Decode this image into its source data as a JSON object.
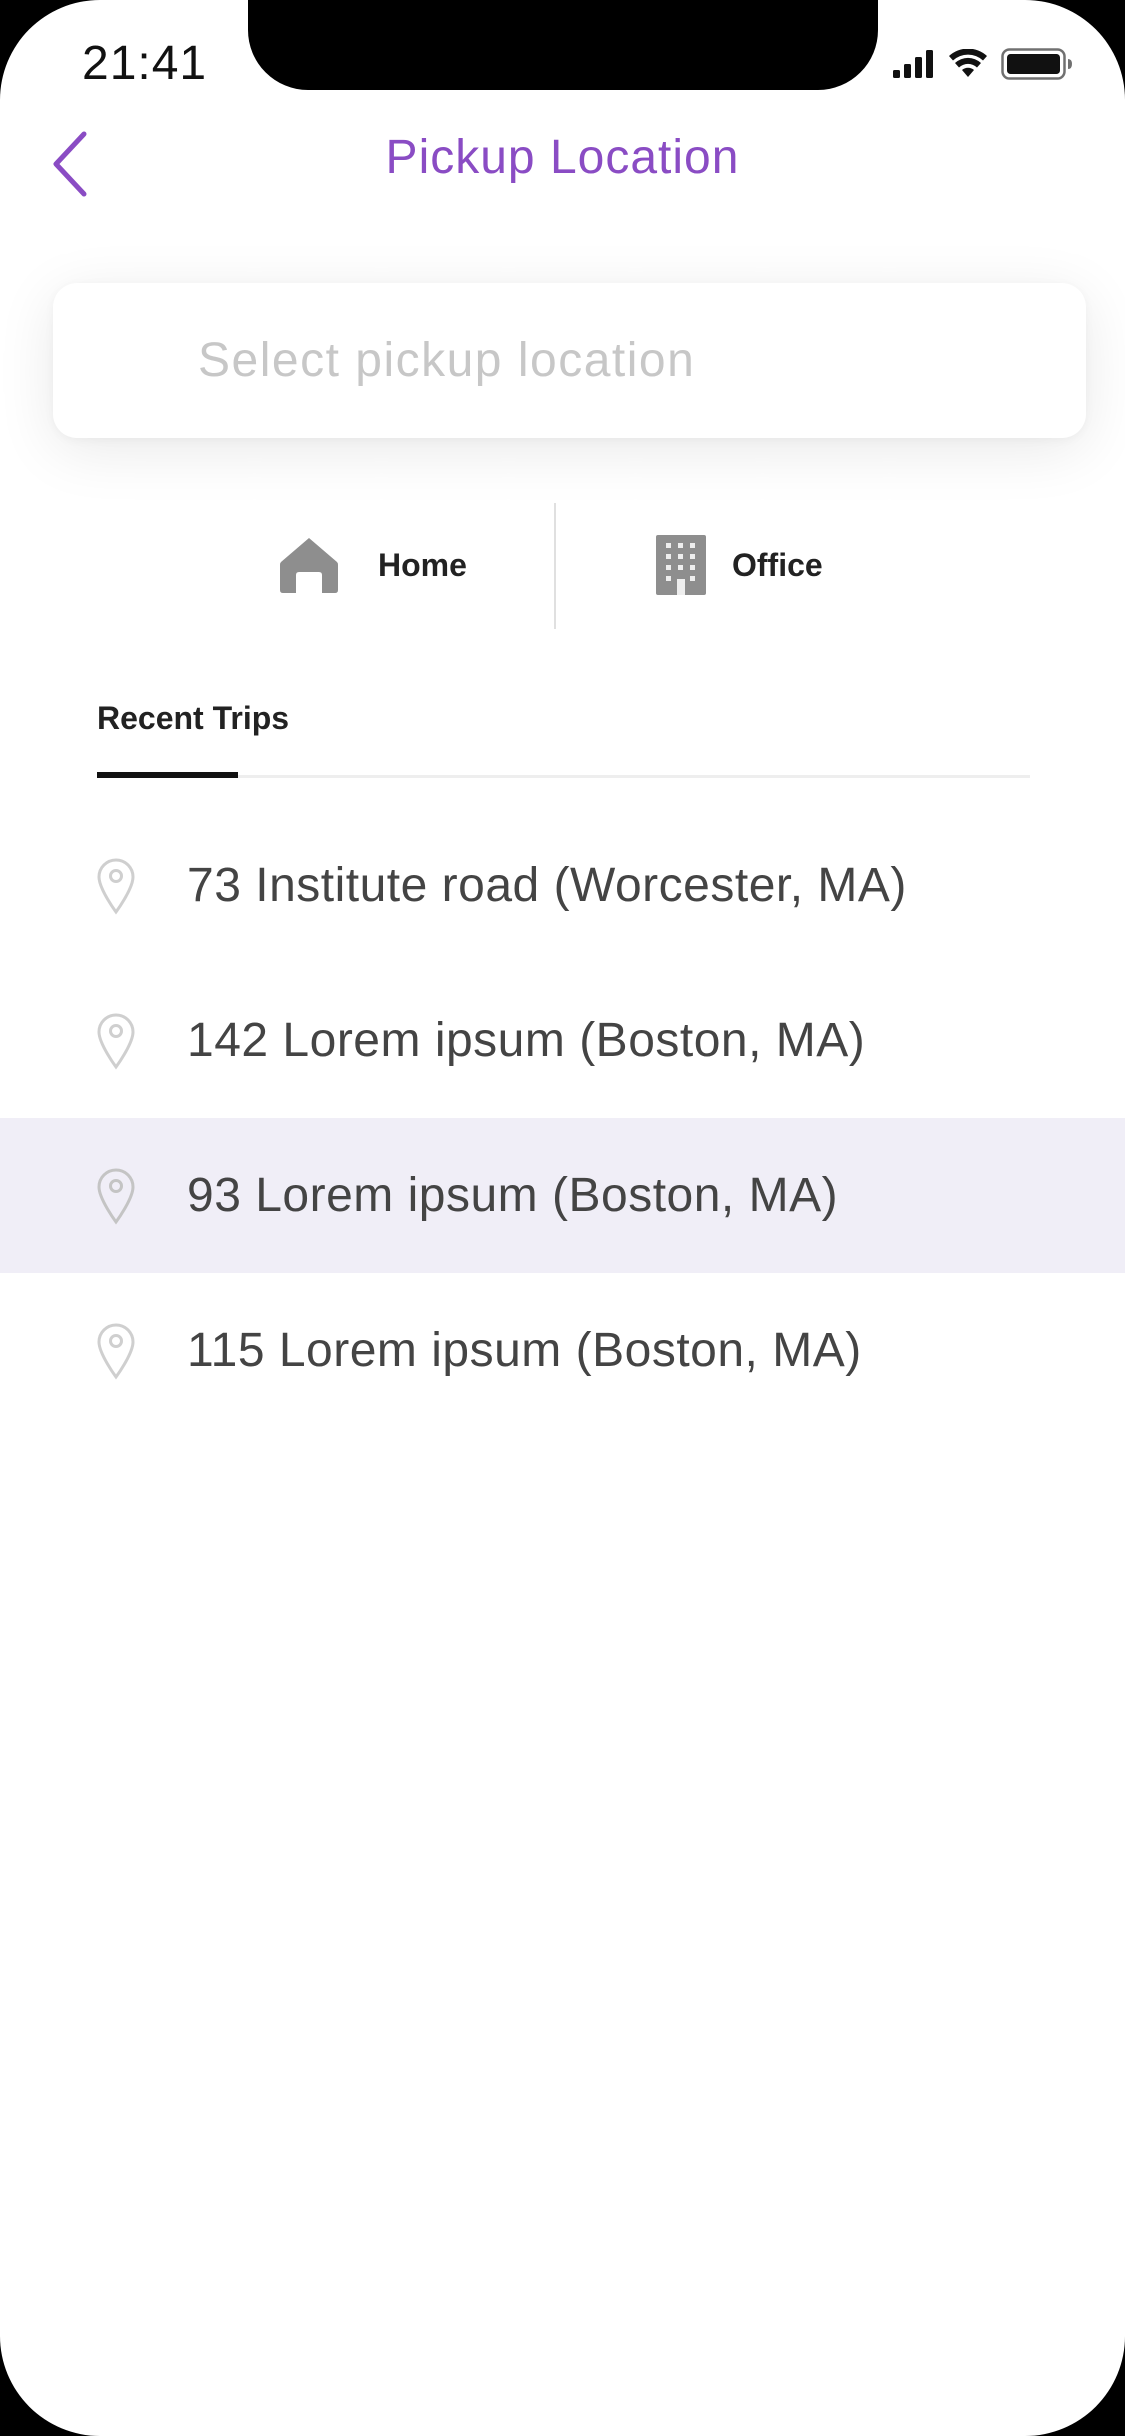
{
  "status_bar": {
    "time": "21:41"
  },
  "header": {
    "title": "Pickup Location"
  },
  "search": {
    "placeholder": "Select pickup location",
    "value": ""
  },
  "shortcuts": {
    "home_label": "Home",
    "home_icon": "house-icon",
    "office_label": "Office",
    "office_icon": "building-icon"
  },
  "tabs": {
    "recent_label": "Recent Trips"
  },
  "recent_trips": [
    {
      "label": "73 Institute road (Worcester, MA)",
      "selected": false
    },
    {
      "label": "142 Lorem ipsum (Boston, MA)",
      "selected": false
    },
    {
      "label": "93 Lorem ipsum (Boston, MA)",
      "selected": true
    },
    {
      "label": "115 Lorem ipsum (Boston, MA)",
      "selected": false
    }
  ],
  "colors": {
    "accent": "#8a4cc4",
    "selected_row": "#f0eef7",
    "icon_gray": "#8e8e8e"
  }
}
